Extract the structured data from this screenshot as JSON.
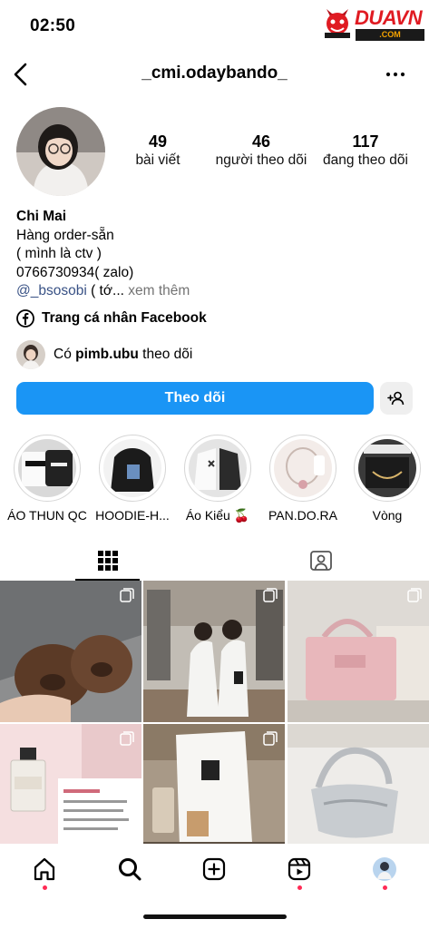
{
  "status": {
    "time": "02:50"
  },
  "watermark": {
    "brand": "DUAVN",
    "sub": ".COM"
  },
  "header": {
    "username": "_cmi.odaybando_"
  },
  "stats": [
    {
      "value": "49",
      "label": "bài viết"
    },
    {
      "value": "46",
      "label": "người theo dõi"
    },
    {
      "value": "117",
      "label": "đang theo dõi"
    }
  ],
  "bio": {
    "name": "Chi Mai",
    "lines": [
      "Hàng order-sẵn",
      "( mình là ctv )",
      "0766730934( zalo)"
    ],
    "mention": "@_bsosobi",
    "tail": " ( tớ...",
    "more": " xem thêm"
  },
  "facebook": {
    "label": "Trang cá nhân Facebook"
  },
  "followed_by": {
    "prefix": "Có ",
    "user": "pimb.ubu",
    "suffix": " theo dõi"
  },
  "actions": {
    "follow_label": "Theo dõi"
  },
  "highlights": [
    {
      "label": "ÁO THUN QC"
    },
    {
      "label": "HOODIE-H..."
    },
    {
      "label": "Áo Kiểu 🍒"
    },
    {
      "label": "PAN.DO.RA"
    },
    {
      "label": "Vòng"
    }
  ],
  "colors": {
    "primary_button": "#1a95f5",
    "mention": "#385185",
    "notification_dot": "#ff2a55",
    "watermark": "#e01b22"
  },
  "icons": [
    "back-arrow-icon",
    "more-dots-icon",
    "facebook-icon",
    "add-person-icon",
    "grid-icon",
    "tagged-icon",
    "multiple-posts-icon",
    "home-icon",
    "search-icon",
    "create-icon",
    "reels-icon"
  ]
}
